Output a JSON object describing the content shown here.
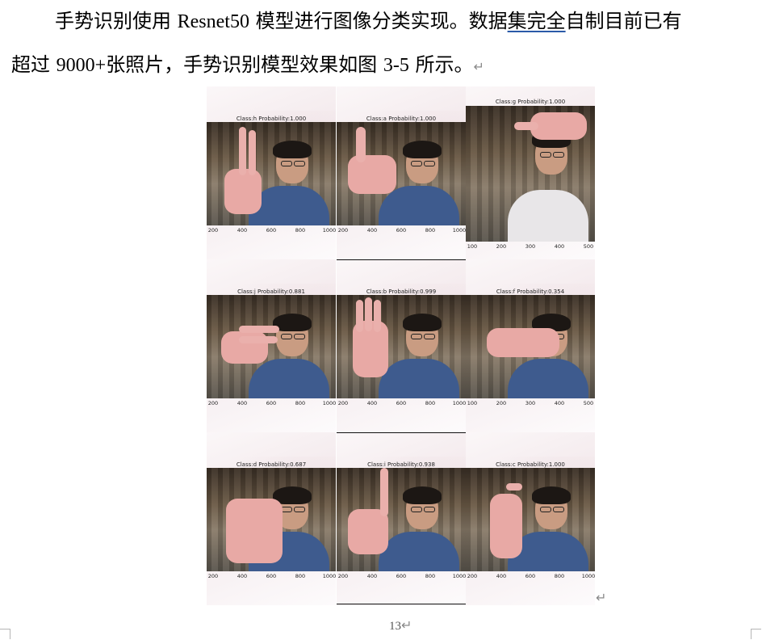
{
  "paragraph": {
    "line1_a": "手势识别使用 ",
    "line1_b": "Resnet50",
    "line1_c": " 模型进行图像分类实现。数据",
    "line1_underlined": "集完全",
    "line1_d": "自制目前已有",
    "line2_a": "超过 ",
    "line2_b": "9000+",
    "line2_c": "张照片，手势识别模型效果如图 ",
    "line2_d": "3-5",
    "line2_e": " 所示。",
    "return_mark": "↵"
  },
  "figure": {
    "panels": [
      {
        "title": "Class:h Probability:1.000",
        "ticks": [
          "200",
          "400",
          "600",
          "800",
          "1000"
        ],
        "shirt": "blue",
        "hand": "two-fingers-up"
      },
      {
        "title": "Class:a Probability:1.000",
        "ticks": [
          "200",
          "400",
          "600",
          "800",
          "1000"
        ],
        "shirt": "blue",
        "hand": "thumb"
      },
      {
        "title": "Class:g Probability:1.000",
        "ticks": [
          "100",
          "200",
          "300",
          "400",
          "500"
        ],
        "shirt": "white",
        "hand": "above-head"
      },
      {
        "title": "Class:j Probability:0.881",
        "ticks": [
          "200",
          "400",
          "600",
          "800",
          "1000"
        ],
        "shirt": "blue",
        "hand": "sideways"
      },
      {
        "title": "Class:b Probability:0.999",
        "ticks": [
          "200",
          "400",
          "600",
          "800",
          "1000"
        ],
        "shirt": "blue",
        "hand": "open-palm"
      },
      {
        "title": "Class:f Probability:0.354",
        "ticks": [
          "100",
          "200",
          "300",
          "400",
          "500"
        ],
        "shirt": "blue",
        "hand": "flat-horizontal"
      },
      {
        "title": "Class:d Probability:0.687",
        "ticks": [
          "200",
          "400",
          "600",
          "800",
          "1000"
        ],
        "shirt": "blue",
        "hand": "fist"
      },
      {
        "title": "Class:i Probability:0.938",
        "ticks": [
          "200",
          "400",
          "600",
          "800",
          "1000"
        ],
        "shirt": "blue",
        "hand": "pinky-up"
      },
      {
        "title": "Class:c Probability:1.000",
        "ticks": [
          "200",
          "400",
          "600",
          "800",
          "1000"
        ],
        "shirt": "blue",
        "hand": "c-shape"
      }
    ]
  },
  "end_mark": "↵",
  "page_number": "13",
  "page_number_mark": "↵",
  "colors": {
    "shirt_blue": "#3e5b8e",
    "skin": "#c99c82",
    "hand": "#e8a9a5",
    "underline": "#2b5aa8"
  }
}
